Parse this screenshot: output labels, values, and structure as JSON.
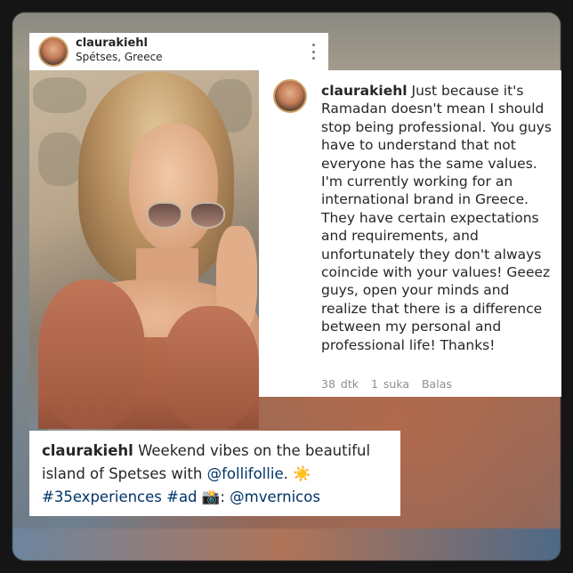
{
  "post": {
    "username": "claurakiehl",
    "location": "Spétses, Greece",
    "more_icon": "vertical-ellipsis-icon"
  },
  "comment": {
    "username": "claurakiehl",
    "text": "Just because it's Ramadan doesn't mean I should stop being professional. You guys have to understand that not everyone has the same values. I'm currently working for an international brand in Greece. They have certain expectations and requirements, and unfortunately they don't always coincide with your values! Geeez guys, open your minds and realize that there is a difference between my personal and professional life! Thanks!",
    "time": "38 dtk",
    "likes": "1 suka",
    "reply": "Balas"
  },
  "caption": {
    "username": "claurakiehl",
    "text_part1": "Weekend vibes on the beautiful island of Spetses with",
    "mention1": "@follifollie",
    "text_part2": ".",
    "sun_emoji": "☀️",
    "hashtag1": "#35experiences",
    "hashtag2": "#ad",
    "camera_emoji": "📸",
    "colon": ":",
    "mention2": "@mvernicos"
  },
  "colors": {
    "link": "#003569",
    "text": "#262626",
    "meta": "#8e8e8e"
  }
}
